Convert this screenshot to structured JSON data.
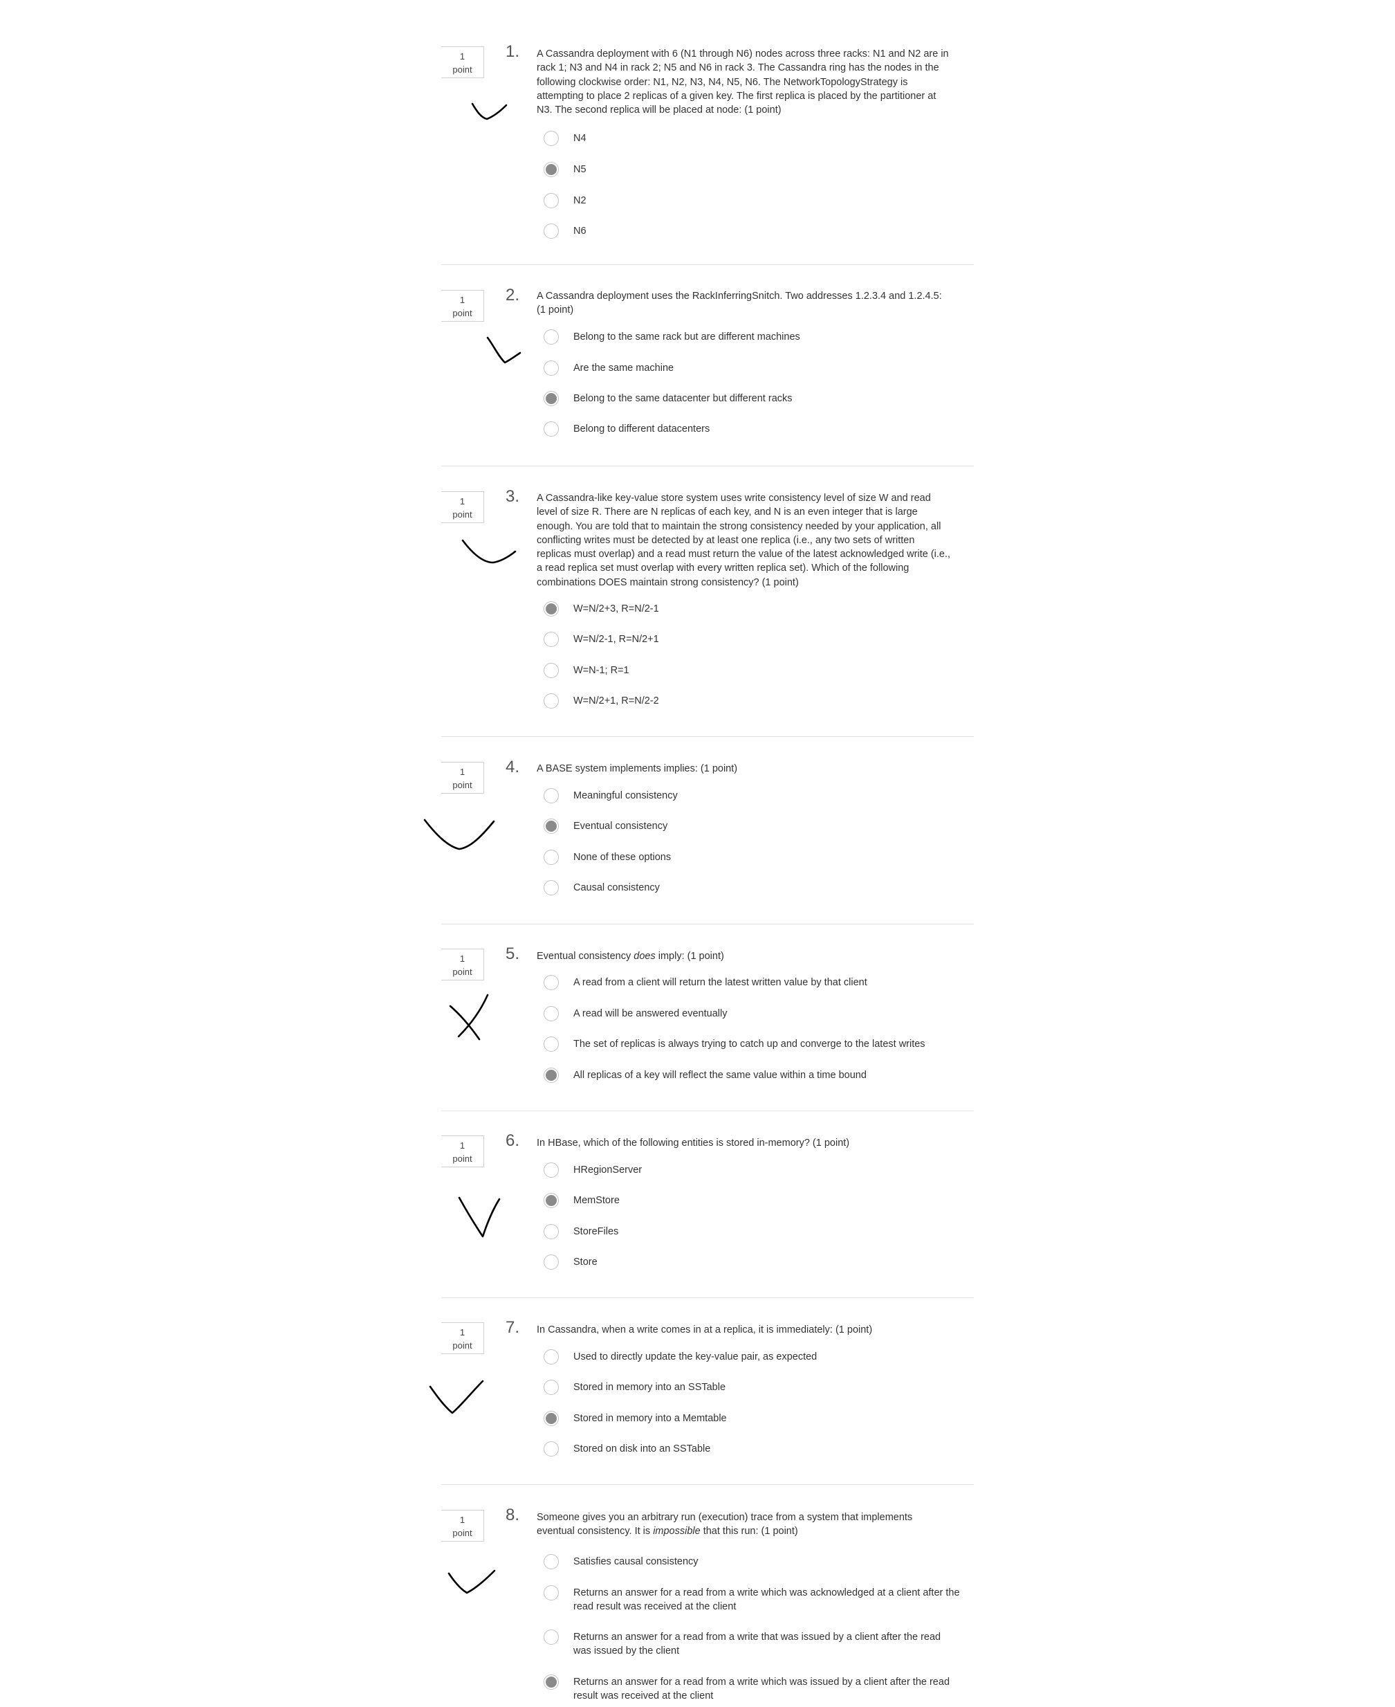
{
  "point_label": "point",
  "questions": [
    {
      "number": "1.",
      "points": "1",
      "text": "A Cassandra deployment with 6 (N1 through N6) nodes across three racks: N1 and N2 are in rack 1; N3 and N4 in rack 2; N5 and N6 in rack 3. The Cassandra ring has the nodes in the following clockwise order: N1, N2, N3, N4, N5, N6. The NetworkTopologyStrategy is attempting to place 2 replicas of a given key. The first replica is placed by the partitioner at N3. The second replica will be placed at node: (1 point)",
      "options": [
        "N4",
        "N5",
        "N2",
        "N6"
      ],
      "selected": 1,
      "mark": "check"
    },
    {
      "number": "2.",
      "points": "1",
      "text": "A Cassandra deployment uses the RackInferringSnitch. Two addresses 1.2.3.4 and 1.2.4.5: (1 point)",
      "options": [
        "Belong to the same rack but are different machines",
        "Are the same machine",
        "Belong to the same datacenter but different racks",
        "Belong to different datacenters"
      ],
      "selected": 2,
      "mark": "check"
    },
    {
      "number": "3.",
      "points": "1",
      "text": "A Cassandra-like key-value store system uses write consistency level of size W and read level of size R. There are N replicas of each key, and N is an even integer that is large enough. You are told that to maintain the strong consistency needed by your application, all conflicting writes must be detected by at least one replica (i.e., any two sets of written replicas must overlap) and a read must return the value of the latest acknowledged write (i.e., a read replica set must overlap with every written replica set). Which of the following combinations DOES maintain strong consistency? (1 point)",
      "options": [
        "W=N/2+3, R=N/2-1",
        "W=N/2-1, R=N/2+1",
        "W=N-1; R=1",
        "W=N/2+1, R=N/2-2"
      ],
      "selected": 0,
      "mark": "check"
    },
    {
      "number": "4.",
      "points": "1",
      "text": "A BASE system implements implies: (1 point)",
      "options": [
        "Meaningful consistency",
        "Eventual consistency",
        "None of these options",
        "Causal consistency"
      ],
      "selected": 1,
      "mark": "check"
    },
    {
      "number": "5.",
      "points": "1",
      "text_before": "Eventual consistency ",
      "text_em": "does",
      "text_after": " imply: (1 point)",
      "options": [
        "A read from a client will return the latest written value by that client",
        "A read will be answered eventually",
        "The set of replicas is always trying to catch up and converge to the latest writes",
        "All replicas of a key will reflect the same value within a time bound"
      ],
      "selected": 3,
      "mark": "cross"
    },
    {
      "number": "6.",
      "points": "1",
      "text": "In HBase, which of the following entities is stored in-memory? (1 point)",
      "options": [
        "HRegionServer",
        "MemStore",
        "StoreFiles",
        "Store"
      ],
      "selected": 1,
      "mark": "check"
    },
    {
      "number": "7.",
      "points": "1",
      "text": "In Cassandra, when a write comes in at a replica, it is immediately: (1 point)",
      "options": [
        "Used to directly update the key-value pair, as expected",
        "Stored in memory into an SSTable",
        "Stored in memory into a Memtable",
        "Stored on disk into an SSTable"
      ],
      "selected": 2,
      "mark": "check"
    },
    {
      "number": "8.",
      "points": "1",
      "text_before": "Someone gives you an arbitrary run (execution) trace from a system that implements eventual consistency. It is ",
      "text_em": "impossible",
      "text_after": " that this run: (1 point)",
      "options": [
        "Satisfies causal consistency",
        "Returns an answer for a read from a write which was acknowledged at a client after the read result was received at the client",
        "Returns an answer for a read from a write that was issued by a client after the read was issued by the client",
        "Returns an answer for a read from a write which was issued by a client after the read result was received at the client"
      ],
      "selected": 3,
      "mark": "check"
    }
  ]
}
